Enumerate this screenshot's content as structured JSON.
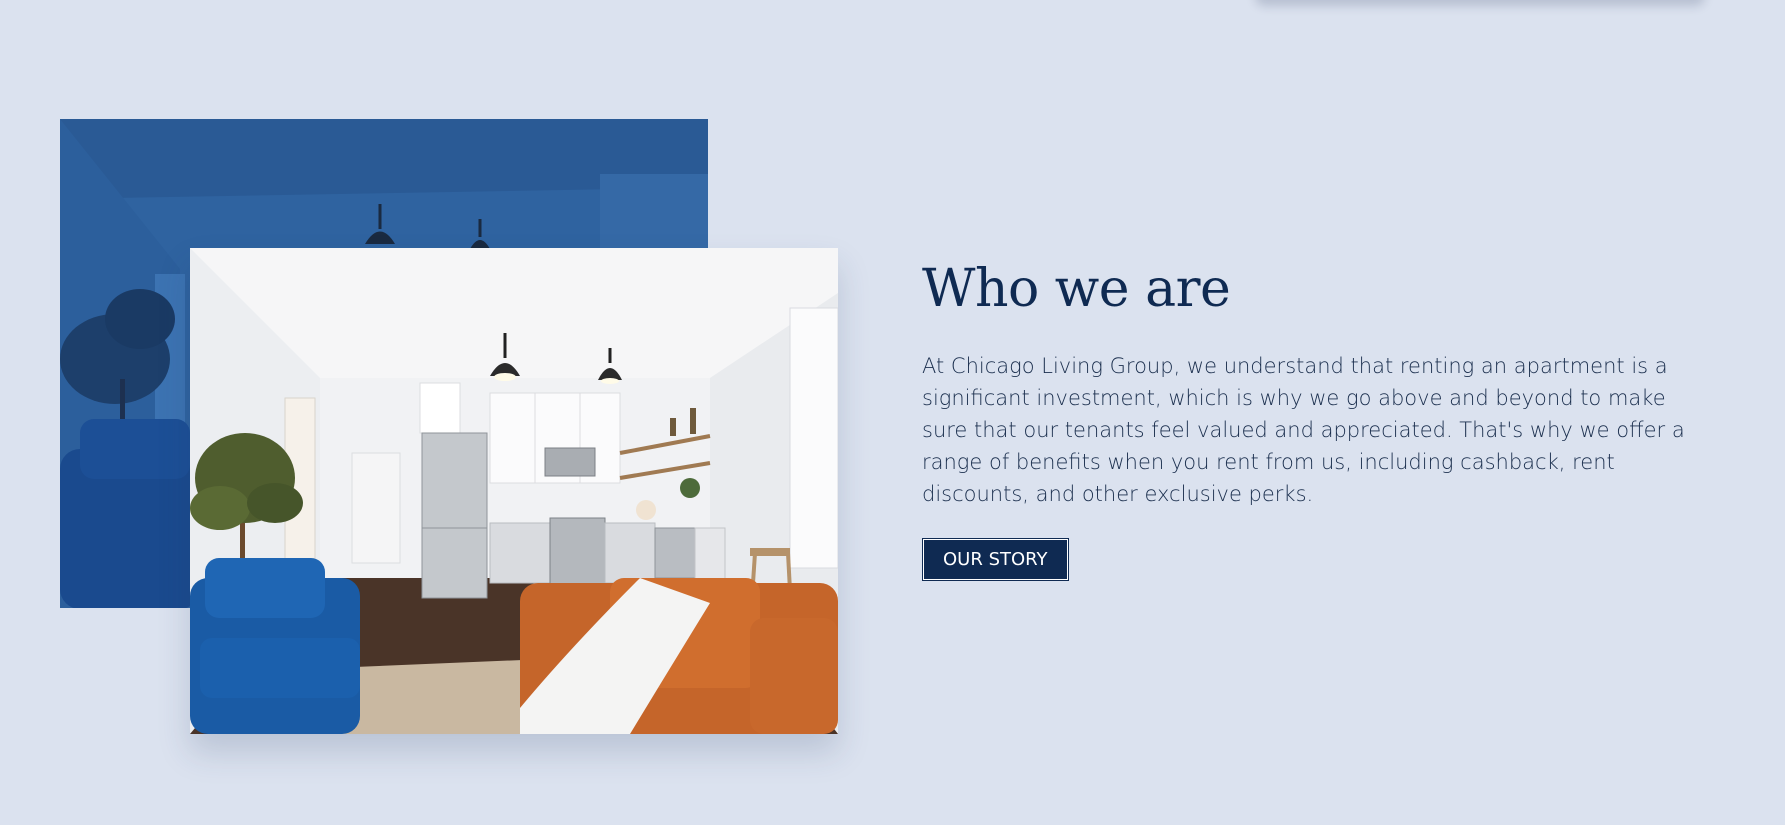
{
  "section": {
    "heading": "Who we are",
    "body": "At Chicago Living Group, we understand that renting an apartment is a significant investment, which is why we go above and beyond to make sure that our tenants feel valued and appreciated. That's why we offer a range of benefits when you rent from us, including cashback, rent discounts, and other exclusive perks.",
    "button_label": "OUR STORY"
  },
  "colors": {
    "background": "#dbe2ef",
    "brand_navy": "#0f2a52",
    "photo_tint": "#2f63a0"
  }
}
